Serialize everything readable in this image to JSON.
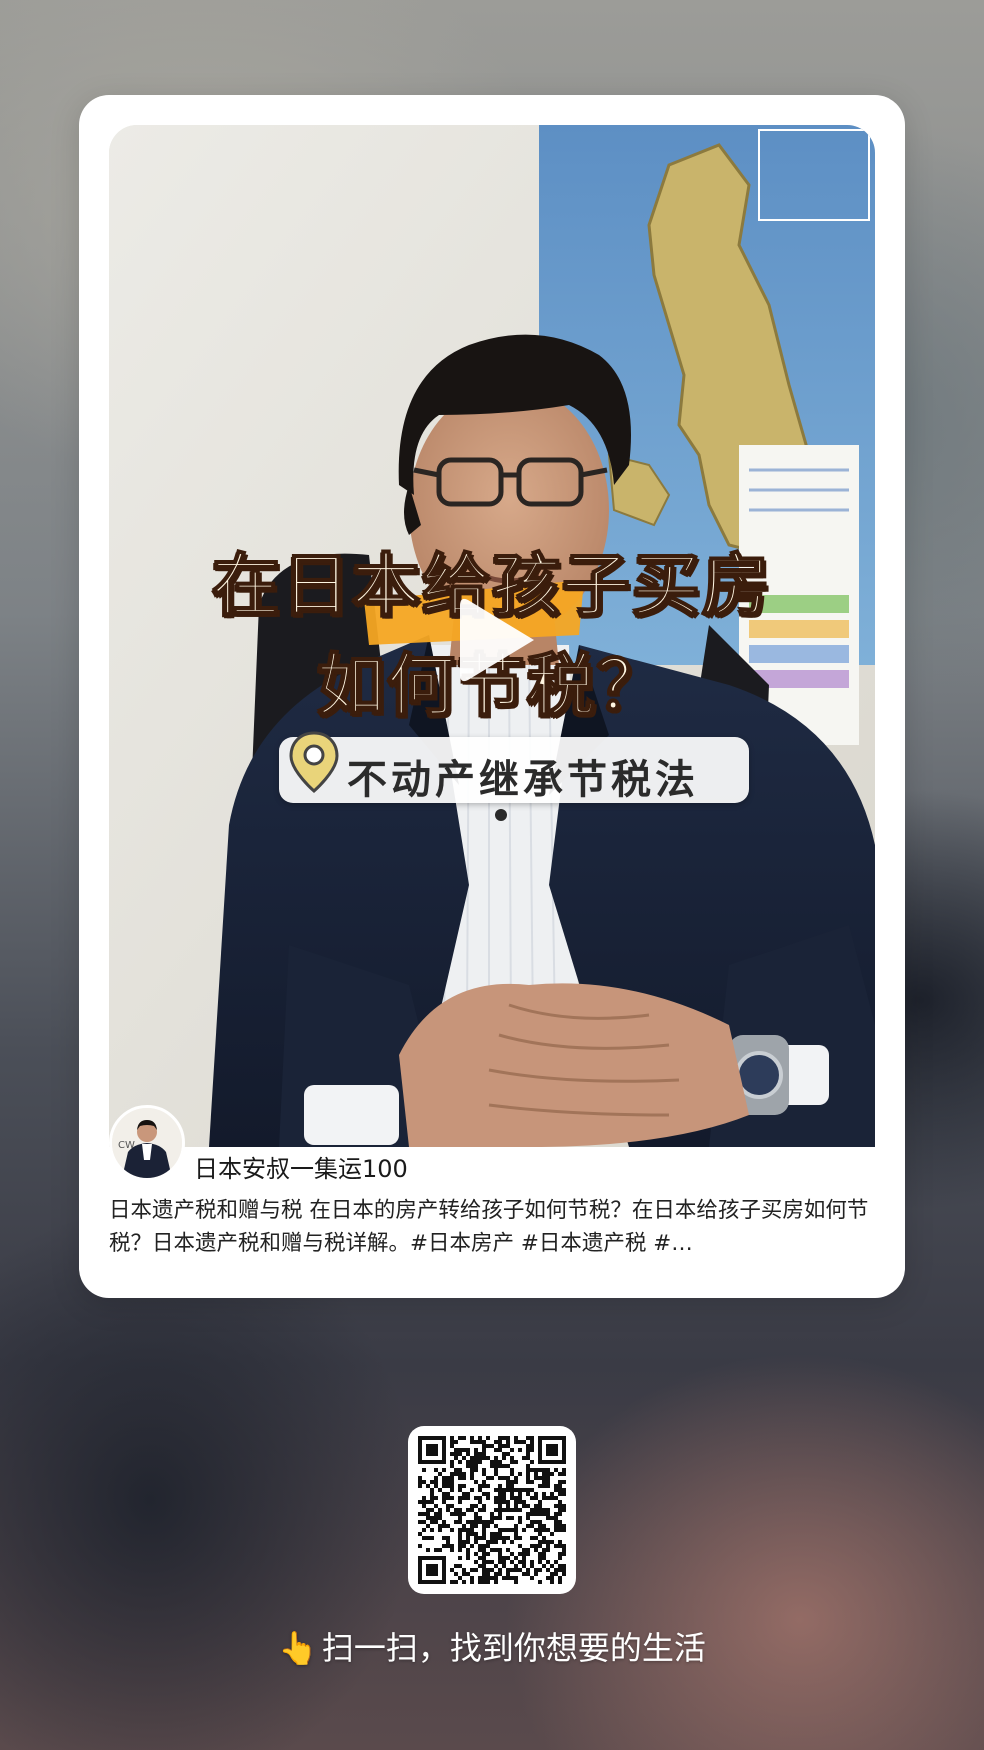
{
  "card": {
    "video": {
      "title_line1": "在日本给孩子买房",
      "title_line2": "如何节税？",
      "tag": "不动产继承节税法",
      "icons": {
        "play": "play-icon",
        "location": "location-pin-icon"
      }
    },
    "author": {
      "name": "日本安叔一集运100",
      "avatar": "author-avatar"
    },
    "description": "日本遗产税和赠与税 在日本的房产转给孩子如何节税？在日本给孩子买房如何节税？日本遗产税和赠与税详解。#日本房产 #日本遗产税 #…"
  },
  "qr": {
    "icon": "qr-code-icon"
  },
  "footer": {
    "hand_icon": "👆",
    "caption": "扫一扫，找到你想要的生活"
  },
  "colors": {
    "card_bg": "#ffffff",
    "title_fill": "#fff6e2",
    "title_stroke": "#3b1d0c",
    "highlight": "#f5a623",
    "pin": "#e9d47a"
  }
}
